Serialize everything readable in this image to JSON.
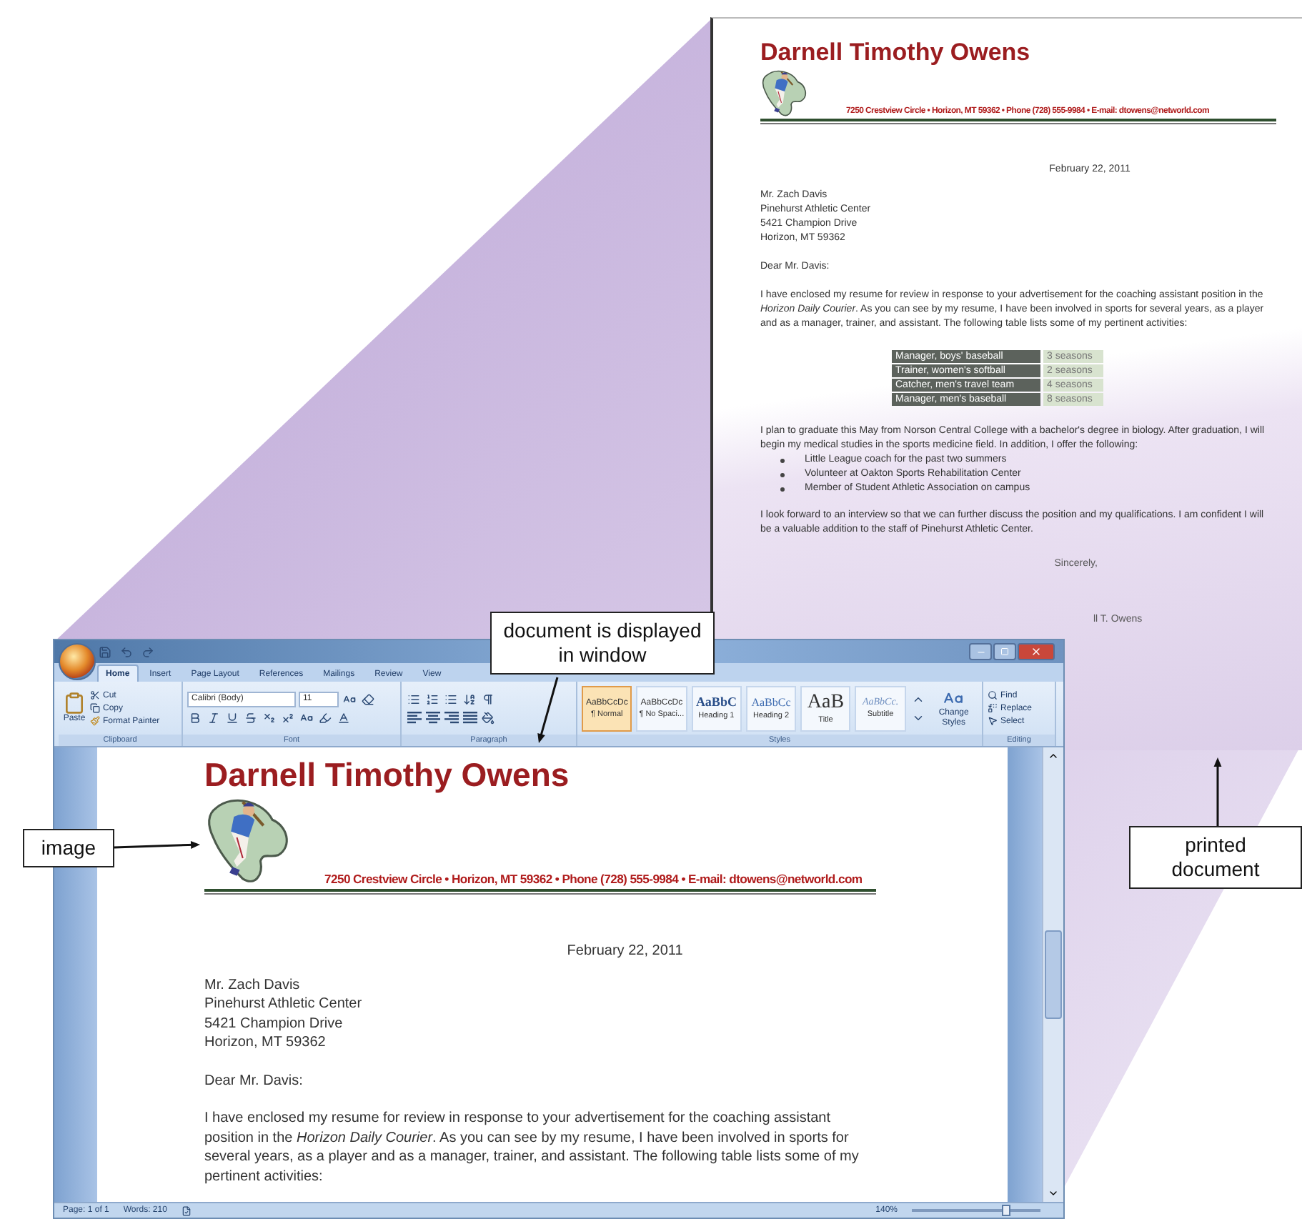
{
  "callouts": {
    "window_label": "document is displayed in window",
    "image_label": "image",
    "printed_label": "printed document"
  },
  "printed_document": {
    "letter": {
      "name": "Darnell Timothy Owens",
      "address_line": "7250 Crestview Circle • Horizon, MT 59362 • Phone (728) 555-9984 • E-mail: dtowens@networld.com",
      "date": "February 22, 2011",
      "recipient": [
        "Mr. Zach Davis",
        "Pinehurst Athletic Center",
        "5421 Champion Drive",
        "Horizon, MT 59362"
      ],
      "salutation": "Dear Mr. Davis:",
      "paragraph": "I have enclosed my resume for review in response to your advertisement for the coaching assistant position in the *Horizon Daily Courier*. As you can see by my resume, I have been involved in sports for several years, as a player and as a manager, trainer, and assistant. The following table lists some of my pertinent activities:"
    },
    "table": [
      {
        "role": "Manager, boys' baseball",
        "duration": "3 seasons"
      },
      {
        "role": "Trainer, women's softball",
        "duration": "2 seasons"
      },
      {
        "role": "Catcher, men's travel team",
        "duration": "4 seasons"
      },
      {
        "role": "Manager, men's baseball",
        "duration": "8 seasons"
      }
    ],
    "paragraph_2": "I plan to graduate this May from Norson Central College with a bachelor's degree in biology. After graduation, I will begin my medical studies in the sports medicine field. In addition, I offer the following:",
    "bullets": [
      "Little League coach for the past two summers",
      "Volunteer at Oakton Sports Rehabilitation Center",
      "Member of Student Athletic Association on campus"
    ],
    "paragraph_3": "I look forward to an interview so that we can further discuss the position and my qualifications. I am confident I will be a valuable addition to the staff of Pinehurst Athletic Center.",
    "closing": "Sincerely,",
    "signature": "ll T. Owens"
  },
  "word_window": {
    "tabs": [
      {
        "label": "Home",
        "selected": true
      },
      {
        "label": "Insert",
        "selected": false
      },
      {
        "label": "Page Layout",
        "selected": false
      },
      {
        "label": "References",
        "selected": false
      },
      {
        "label": "Mailings",
        "selected": false
      },
      {
        "label": "Review",
        "selected": false
      },
      {
        "label": "View",
        "selected": false
      }
    ],
    "clipboard": {
      "paste": "Paste",
      "cut": "Cut",
      "copy": "Copy",
      "format_painter": "Format Painter"
    },
    "font": {
      "name": "Calibri (Body)",
      "size": "11"
    },
    "group_labels": [
      "Clipboard",
      "Font",
      "Paragraph",
      "Styles",
      "Editing"
    ],
    "styles": [
      {
        "kind": "normal",
        "preview": "AaBbCcDc",
        "name": "¶ Normal",
        "selected": true
      },
      {
        "kind": "no_spacing",
        "preview": "AaBbCcDc",
        "name": "¶ No Spaci...",
        "selected": false
      },
      {
        "kind": "heading1",
        "preview": "AaBbC",
        "name": "Heading 1",
        "selected": false
      },
      {
        "kind": "heading2",
        "preview": "AaBbCc",
        "name": "Heading 2",
        "selected": false
      },
      {
        "kind": "title",
        "preview": "AaB",
        "name": "Title",
        "selected": false
      },
      {
        "kind": "subtitle",
        "preview": "AaBbCc.",
        "name": "Subtitle",
        "selected": false
      }
    ],
    "change_styles": "Change Styles",
    "editing": [
      {
        "kind": "find",
        "label": "Find"
      },
      {
        "kind": "replace",
        "label": "Replace"
      },
      {
        "kind": "select",
        "label": "Select"
      }
    ],
    "document": {
      "name": "Darnell Timothy Owens",
      "address_line": "7250 Crestview Circle • Horizon, MT 59362 • Phone (728) 555-9984 • E-mail: dtowens@networld.com",
      "date": "February 22, 2011",
      "recipient": [
        "Mr. Zach Davis",
        "Pinehurst Athletic Center",
        "5421 Champion Drive",
        "Horizon, MT 59362"
      ],
      "salutation": "Dear Mr. Davis:",
      "paragraph": "I have enclosed my resume for review in response to your advertisement for the coaching assistant position in the *Horizon Daily Courier*. As you can see by my resume, I have been involved in sports for several years, as a player and as a manager, trainer, and assistant. The following table lists some of my pertinent activities:"
    },
    "status_bar": {
      "page": "Page: 1 of 1",
      "words": "Words: 210",
      "zoom": "140%",
      "zoom_slider": {
        "level": 0.72
      }
    }
  }
}
